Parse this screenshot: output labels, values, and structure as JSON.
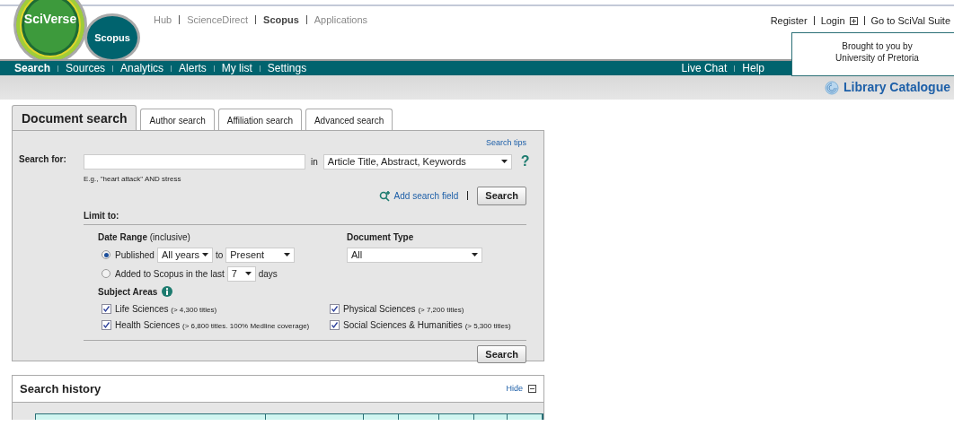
{
  "logo": {
    "brand": "SciVerse",
    "product": "Scopus"
  },
  "top_links": [
    {
      "label": "Hub",
      "selected": false
    },
    {
      "label": "ScienceDirect",
      "selected": false
    },
    {
      "label": "Scopus",
      "selected": true
    },
    {
      "label": "Applications",
      "selected": false
    }
  ],
  "account_links": [
    "Register",
    "Login",
    "Go to SciVal Suite"
  ],
  "sponsor": {
    "line": "Brought to you by",
    "institution": "University of Pretoria"
  },
  "nav": [
    {
      "label": "Search",
      "selected": true
    },
    {
      "label": "Sources",
      "selected": false
    },
    {
      "label": "Analytics",
      "selected": false
    },
    {
      "label": "Alerts",
      "selected": false
    },
    {
      "label": "My list",
      "selected": false
    },
    {
      "label": "Settings",
      "selected": false
    }
  ],
  "nav_right": [
    "Live Chat",
    "Help"
  ],
  "library_link": "Library Catalogue",
  "tabs": [
    {
      "label": "Document search",
      "selected": true
    },
    {
      "label": "Author search",
      "selected": false
    },
    {
      "label": "Affiliation search",
      "selected": false
    },
    {
      "label": "Advanced search",
      "selected": false
    }
  ],
  "search_tips": "Search tips",
  "search_label": "Search for:",
  "search_hint": "E.g., \"heart attack\" AND stress",
  "in_label": "in",
  "field_select": "Article Title, Abstract, Keywords",
  "help_mark": "?",
  "add_search_field": "Add search field",
  "search_button": "Search",
  "limit_label": "Limit to:",
  "date_range_label": "**Date Range** (inclusive)",
  "date_options": [
    {
      "kind": "published",
      "selected": true,
      "label": "Published",
      "from": "All years",
      "joiner": "to",
      "to": "Present"
    },
    {
      "kind": "added",
      "selected": false,
      "label": "Added to Scopus in the last",
      "value": "7",
      "unit": "days"
    }
  ],
  "document_type": {
    "label": "Document Type",
    "value": "All"
  },
  "subject_areas": {
    "label": "Subject Areas",
    "items": [
      {
        "name": "Life Sciences",
        "note": "(> 4,300 titles)",
        "checked": true
      },
      {
        "name": "Physical Sciences",
        "note": "(> 7,200 titles)",
        "checked": true
      },
      {
        "name": "Health Sciences",
        "note": "(> 6,800 titles. 100% Medline coverage)",
        "checked": true
      },
      {
        "name": "Social Sciences & Humanities",
        "note": "(> 5,300 titles)",
        "checked": true
      }
    ]
  },
  "bottom_search_button": "Search",
  "history": {
    "title": "Search history",
    "toggle": "Hide"
  }
}
